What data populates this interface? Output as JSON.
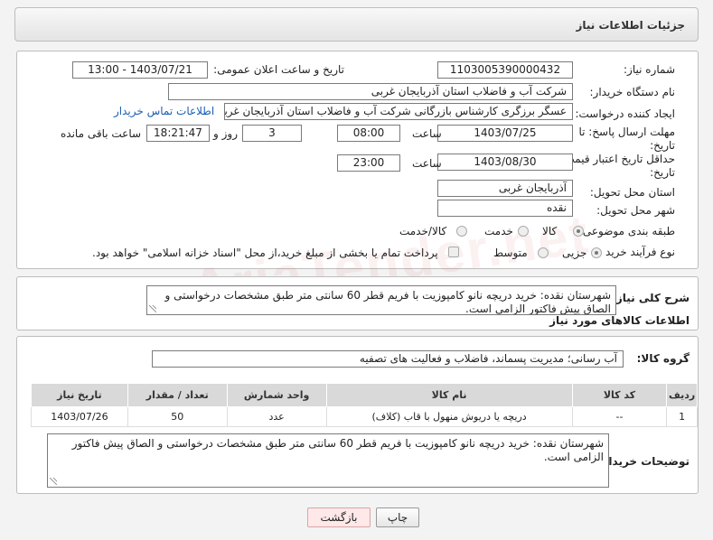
{
  "header": {
    "title": "جزئیات اطلاعات نیاز"
  },
  "form": {
    "need_number_label": "شماره نیاز:",
    "need_number": "1103005390000432",
    "announce_label": "تاریخ و ساعت اعلان عمومی:",
    "announce_value": "1403/07/21 - 13:00",
    "buyer_org_label": "نام دستگاه خریدار:",
    "buyer_org": "شرکت آب و فاضلاب استان آذربایجان غربی",
    "creator_label": "ایجاد کننده درخواست:",
    "creator": "عسگر  برزگری کارشناس بازرگانی شرکت آب و فاضلاب استان آذربایجان غربی",
    "contact_link": "اطلاعات تماس خریدار",
    "deadline_label_1": "مهلت ارسال پاسخ: تا",
    "deadline_label_2": "تاریخ:",
    "deadline_date": "1403/07/25",
    "time_label": "ساعت",
    "deadline_time": "08:00",
    "days_value": "3",
    "days_label": "روز و",
    "remaining_time": "18:21:47",
    "remaining_label": "ساعت باقی مانده",
    "validity_label_1": "حداقل تاریخ اعتبار قیمت: تا",
    "validity_label_2": "تاریخ:",
    "validity_date": "1403/08/30",
    "validity_time": "23:00",
    "province_label": "استان محل تحویل:",
    "province": "آذربایجان غربی",
    "city_label": "شهر محل تحویل:",
    "city": "نقده",
    "category_label": "طبقه بندی موضوعی:",
    "category_options": [
      "کالا",
      "خدمت",
      "کالا/خدمت"
    ],
    "process_label": "نوع فرآیند خرید :",
    "process_options": [
      "جزیی",
      "متوسط"
    ],
    "treasury_note": "پرداخت تمام یا بخشی از مبلغ خرید،از محل \"اسناد خزانه اسلامی\" خواهد بود."
  },
  "description": {
    "label": "شرح کلی نیاز:",
    "text": "شهرستان نقده: خرید  دریچه نانو کامپوزیت با فریم قطر 60 سانتی متر طبق مشخصات درخواستی و الصاق پیش فاکتور الزامی است."
  },
  "goods": {
    "section_title": "اطلاعات کالاهای مورد نیاز",
    "group_label": "گروه کالا:",
    "group_value": "آب رسانی؛ مدیریت پسماند، فاضلاب و فعالیت های تصفیه",
    "columns": [
      "ردیف",
      "کد کالا",
      "نام کالا",
      "واحد شمارش",
      "تعداد / مقدار",
      "تاریخ نیاز"
    ],
    "rows": [
      {
        "row": "1",
        "code": "--",
        "name": "دریچه یا دریوش منهول با قاب (کلاف)",
        "unit": "عدد",
        "qty": "50",
        "date": "1403/07/26"
      }
    ]
  },
  "buyer_notes": {
    "label": "توضیحات خریدار:",
    "text": "شهرستان نقده: خرید  دریچه نانو کامپوزیت با فریم قطر 60 سانتی متر طبق مشخصات درخواستی و الصاق پیش فاکتور الزامی است."
  },
  "buttons": {
    "print": "چاپ",
    "back": "بازگشت"
  }
}
